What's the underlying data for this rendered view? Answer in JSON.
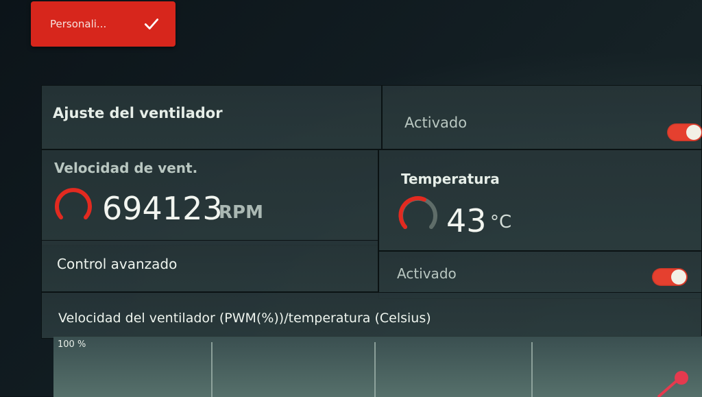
{
  "profile_button": {
    "label": "Personali...",
    "icon": "check-icon"
  },
  "fan_setting": {
    "title": "Ajuste del ventilador",
    "status": "Activado",
    "enabled": true
  },
  "fan_speed": {
    "title": "Velocidad de vent.",
    "value": "694123",
    "unit": "RPM"
  },
  "temperature": {
    "title": "Temperatura",
    "value": "43",
    "unit": "°C"
  },
  "advanced_control": {
    "title": "Control avanzado",
    "status": "Activado",
    "enabled": true
  },
  "fan_curve": {
    "title": "Velocidad del ventilador (PWM(%))/temperatura (Celsius)",
    "y_max_label": "100 %"
  },
  "colors": {
    "accent": "#d7261c",
    "toggle": "#e5402f"
  }
}
